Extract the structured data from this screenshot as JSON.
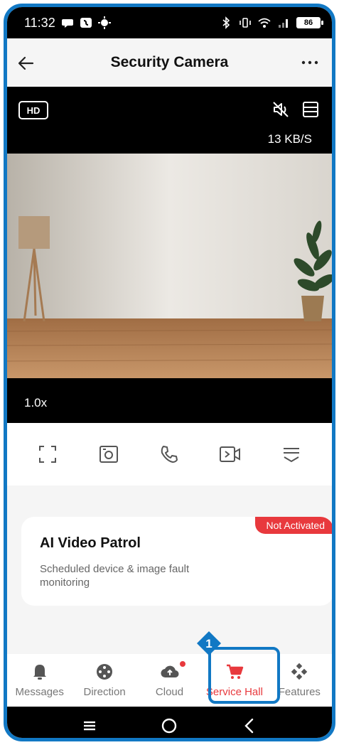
{
  "status_bar": {
    "time": "11:32",
    "battery": "86",
    "left_icons": [
      "chat-bubble-icon",
      "sim-toolkit-icon",
      "sun-icon"
    ],
    "right_icons": [
      "bluetooth-icon",
      "vibrate-icon",
      "wifi-icon",
      "signal-icon",
      "battery-icon"
    ]
  },
  "header": {
    "title": "Security Camera",
    "back_icon": "back-arrow-icon",
    "more_icon": "more-dots-icon"
  },
  "video": {
    "quality_label": "HD",
    "bitrate": "13 KB/S",
    "zoom": "1.0x",
    "icons": [
      "speaker-muted-icon",
      "layout-icon"
    ]
  },
  "controls": [
    {
      "name": "fullscreen-icon"
    },
    {
      "name": "screenshot-icon"
    },
    {
      "name": "call-icon"
    },
    {
      "name": "record-icon"
    },
    {
      "name": "expand-icon"
    }
  ],
  "card": {
    "badge": "Not Activated",
    "title": "AI Video Patrol",
    "description": "Scheduled device & image fault monitoring"
  },
  "bottom_nav": {
    "items": [
      {
        "label": "Messages",
        "icon": "bell-icon"
      },
      {
        "label": "Direction",
        "icon": "direction-pad-icon"
      },
      {
        "label": "Cloud",
        "icon": "cloud-upload-icon"
      },
      {
        "label": "Service Hall",
        "icon": "cart-icon"
      },
      {
        "label": "Features",
        "icon": "features-diamond-icon"
      }
    ],
    "active_index": 3
  },
  "annotation": {
    "step_number": "1"
  },
  "colors": {
    "accent": "#e8393d",
    "highlight": "#1178c4"
  }
}
